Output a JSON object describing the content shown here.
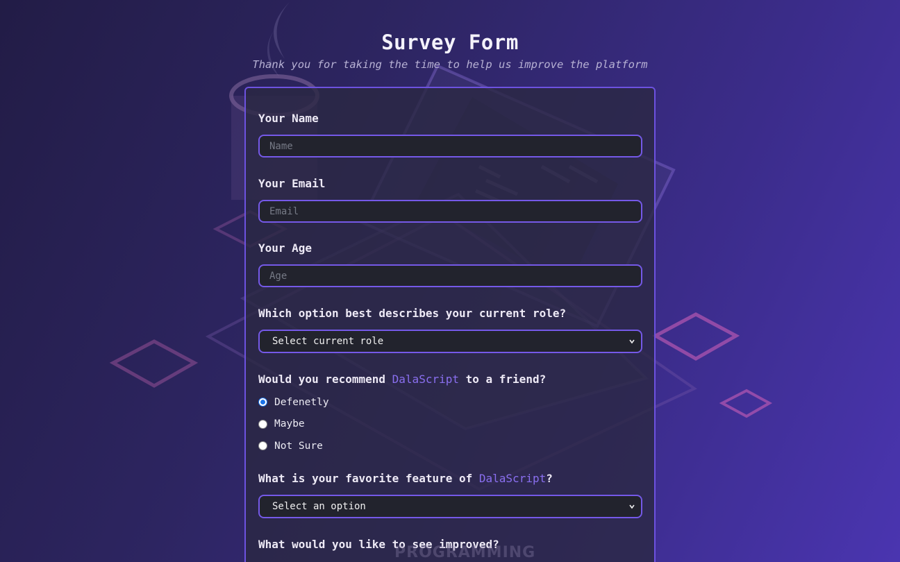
{
  "header": {
    "title": "Survey Form",
    "subtitle": "Thank you for taking the time to help us improve the platform"
  },
  "form": {
    "name": {
      "label": "Your Name",
      "placeholder": "Name",
      "value": ""
    },
    "email": {
      "label": "Your Email",
      "placeholder": "Email",
      "value": ""
    },
    "age": {
      "label": "Your Age",
      "placeholder": "Age",
      "value": ""
    },
    "role": {
      "label": "Which option best describes your current role?",
      "selected": "Select current role"
    },
    "recommend": {
      "label_before": "Would you recommend ",
      "label_brand": "DalaScript",
      "label_after": " to a friend?",
      "options": [
        {
          "label": "Defenetly",
          "checked": true
        },
        {
          "label": "Maybe",
          "checked": false
        },
        {
          "label": "Not Sure",
          "checked": false
        }
      ]
    },
    "feature": {
      "label_before": "What is your favorite feature of ",
      "label_brand": "DalaScript",
      "label_after": "?",
      "selected": "Select an option"
    },
    "improve": {
      "label": "What would you like to see improved?"
    }
  },
  "background": {
    "watermark_text": "PROGRAMMING"
  },
  "colors": {
    "accent": "#7559e8",
    "brand_text": "#8a6ff0",
    "radio_checked": "#1a73e8"
  }
}
